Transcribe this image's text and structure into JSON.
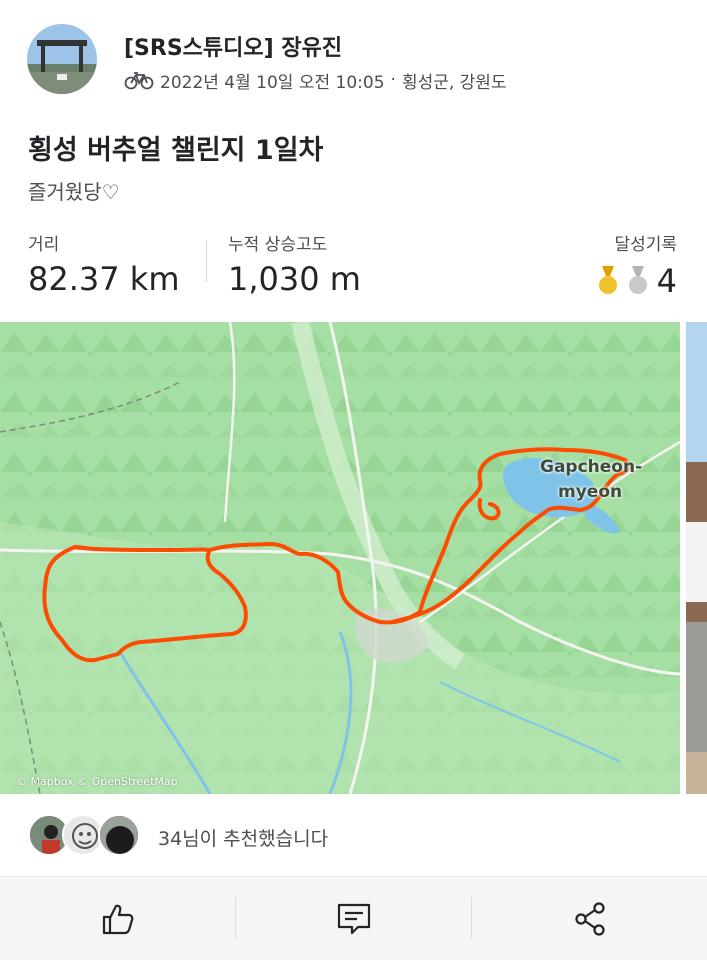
{
  "author": {
    "name": "[SRS스튜디오] 장유진",
    "avatar_icon": "profile-photo-gate"
  },
  "meta": {
    "activity_icon": "bike-icon",
    "datetime": "2022년 4월 10일 오전 10:05",
    "separator": "·",
    "location": "횡성군, 강원도"
  },
  "activity": {
    "title": "횡성 버추얼 챌린지 1일차",
    "description": "즐거웠당♡"
  },
  "stats": {
    "distance": {
      "label": "거리",
      "value": "82.37 km"
    },
    "elevation": {
      "label": "누적 상승고도",
      "value": "1,030 m"
    },
    "achievements": {
      "label": "달성기록",
      "count": "4",
      "medal_colors": [
        "#f2c12e",
        "#c9c9cc"
      ]
    }
  },
  "map": {
    "place_label_line1": "Gapcheon-",
    "place_label_line2": "myeon",
    "credit": "© Mapbox © OpenStreetMap",
    "route_color": "#fc4c02"
  },
  "kudos": {
    "text": "34님이 추천했습니다"
  },
  "actions": {
    "like_icon": "thumbs-up-icon",
    "comment_icon": "comment-icon",
    "share_icon": "share-icon"
  }
}
